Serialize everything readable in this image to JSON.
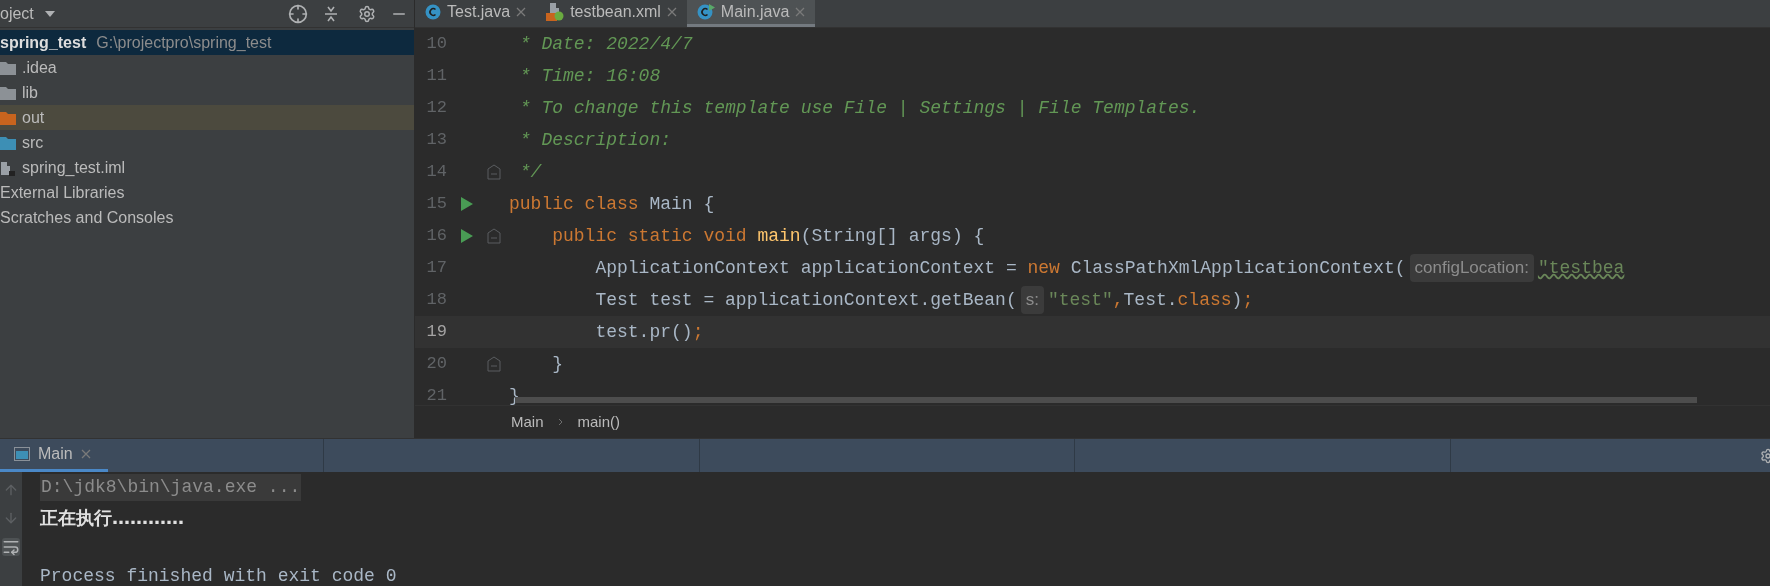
{
  "project_panel": {
    "title": "oject",
    "tree": [
      {
        "label": "spring_test",
        "path": "G:\\projectpro\\spring_test",
        "kind": "module",
        "selected": true,
        "children": [
          {
            "label": ".idea",
            "kind": "folder",
            "color": "#8c9196",
            "selected": false,
            "excluded": false
          },
          {
            "label": "lib",
            "kind": "folder",
            "color": "#8c9196",
            "selected": false,
            "excluded": false
          },
          {
            "label": "out",
            "kind": "folder",
            "color": "#c8641e",
            "selected": false,
            "excluded": true
          },
          {
            "label": "src",
            "kind": "folder",
            "color": "#3d8fb5",
            "selected": false,
            "excluded": false
          },
          {
            "label": "spring_test.iml",
            "kind": "file",
            "selected": false,
            "excluded": false
          }
        ]
      },
      {
        "label": "External Libraries",
        "kind": "plain",
        "selected": false
      },
      {
        "label": "Scratches and Consoles",
        "kind": "plain",
        "selected": false
      }
    ]
  },
  "editor_tabs": [
    {
      "label": "Test.java",
      "kind": "class",
      "selected": false
    },
    {
      "label": "testbean.xml",
      "kind": "xml",
      "selected": false
    },
    {
      "label": "Main.java",
      "kind": "main",
      "selected": true
    }
  ],
  "code_lines": [
    {
      "number": "10",
      "current": false,
      "run_marker": false,
      "fold": false,
      "tokens": [
        {
          "kind": "comment",
          "text": " * Date: 2022/4/7"
        }
      ]
    },
    {
      "number": "11",
      "current": false,
      "run_marker": false,
      "fold": false,
      "tokens": [
        {
          "kind": "comment",
          "text": " * Time: 16:08"
        }
      ]
    },
    {
      "number": "12",
      "current": false,
      "run_marker": false,
      "fold": false,
      "tokens": [
        {
          "kind": "comment",
          "text": " * To change this template use File | Settings | File Templates."
        }
      ]
    },
    {
      "number": "13",
      "current": false,
      "run_marker": false,
      "fold": false,
      "tokens": [
        {
          "kind": "comment",
          "text": " * Description:"
        }
      ]
    },
    {
      "number": "14",
      "current": false,
      "run_marker": false,
      "fold": true,
      "tokens": [
        {
          "kind": "comment",
          "text": " */"
        }
      ]
    },
    {
      "number": "15",
      "current": false,
      "run_marker": true,
      "fold": false,
      "tokens": [
        {
          "kind": "keyword",
          "text": "public class "
        },
        {
          "kind": "plain",
          "text": "Main {"
        }
      ]
    },
    {
      "number": "16",
      "current": false,
      "run_marker": true,
      "fold": true,
      "tokens": [
        {
          "kind": "keyword",
          "text": "    public static void "
        },
        {
          "kind": "method",
          "text": "main"
        },
        {
          "kind": "plain",
          "text": "(String[] args) {"
        }
      ]
    },
    {
      "number": "17",
      "current": false,
      "run_marker": false,
      "fold": false,
      "tokens": [
        {
          "kind": "plain",
          "text": "        ApplicationContext applicationContext = "
        },
        {
          "kind": "keyword",
          "text": "new"
        },
        {
          "kind": "plain",
          "text": " ClassPathXmlApplicationContext("
        },
        {
          "kind": "hint",
          "text": "configLocation:"
        },
        {
          "kind": "warn_string",
          "text": "\"testbea"
        }
      ]
    },
    {
      "number": "18",
      "current": false,
      "run_marker": false,
      "fold": false,
      "tokens": [
        {
          "kind": "plain",
          "text": "        Test test = applicationContext.getBean("
        },
        {
          "kind": "hint",
          "text": "s:"
        },
        {
          "kind": "string",
          "text": "\"test\""
        },
        {
          "kind": "keyword",
          "text": ","
        },
        {
          "kind": "plain",
          "text": "Test."
        },
        {
          "kind": "keyword",
          "text": "class"
        },
        {
          "kind": "plain",
          "text": ")"
        },
        {
          "kind": "keyword",
          "text": ";"
        }
      ]
    },
    {
      "number": "19",
      "current": true,
      "run_marker": false,
      "fold": false,
      "tokens": [
        {
          "kind": "plain",
          "text": "        test.pr()"
        },
        {
          "kind": "keyword",
          "text": ";"
        }
      ]
    },
    {
      "number": "20",
      "current": false,
      "run_marker": false,
      "fold": true,
      "tokens": [
        {
          "kind": "plain",
          "text": "    }"
        }
      ]
    },
    {
      "number": "21",
      "current": false,
      "run_marker": false,
      "fold": false,
      "tokens": [
        {
          "kind": "plain",
          "text": "}"
        }
      ]
    }
  ],
  "breadcrumbs": [
    "Main",
    "main()"
  ],
  "run_panel": {
    "tabs": [
      {
        "label": "Main",
        "selected": true
      }
    ],
    "console": [
      {
        "kind": "command",
        "text": "D:\\jdk8\\bin\\java.exe ..."
      },
      {
        "kind": "output",
        "text": "正在执行…………"
      },
      {
        "kind": "blank"
      },
      {
        "kind": "plain",
        "text": "Process finished with exit code 0"
      }
    ]
  }
}
